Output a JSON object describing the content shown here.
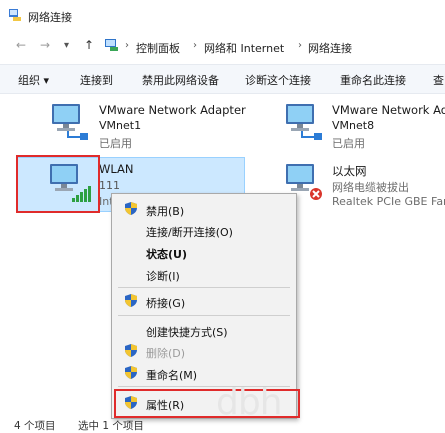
{
  "window": {
    "title": "网络连接"
  },
  "address": {
    "back": "←",
    "forward": "→",
    "down": "▾",
    "up": "↑",
    "crumbs": [
      "控制面板",
      "网络和 Internet",
      "网络连接"
    ]
  },
  "toolbar": {
    "organize": "组织 ▾",
    "connect_to": "连接到",
    "disable_device": "禁用此网络设备",
    "diagnose": "诊断这个连接",
    "rename": "重命名此连接",
    "more": "查"
  },
  "connections": [
    {
      "name": "VMware Network Adapter",
      "sub": "VMnet1",
      "status": "已启用"
    },
    {
      "name": "VMware Network Ad",
      "sub": "VMnet8",
      "status": "已启用"
    },
    {
      "name": "WLAN",
      "sub": "111",
      "status": "Intel"
    },
    {
      "name": "以太网",
      "sub": "网络电缆被拔出",
      "status": "Realtek PCIe GBE Far"
    }
  ],
  "context_menu": {
    "disable": "禁用(B)",
    "connect": "连接/断开连接(O)",
    "status": "状态(U)",
    "diagnose": "诊断(I)",
    "bridge": "桥接(G)",
    "shortcut": "创建快捷方式(S)",
    "delete": "删除(D)",
    "rename": "重命名(M)",
    "properties": "属性(R)"
  },
  "statusbar": {
    "count": "4 个项目",
    "selected": "选中 1 个项目"
  },
  "watermark": "dbh",
  "colors": {
    "selection": "#cce8ff",
    "highlight_box": "#e02b2b",
    "menu_bg": "#f2f2f2"
  }
}
